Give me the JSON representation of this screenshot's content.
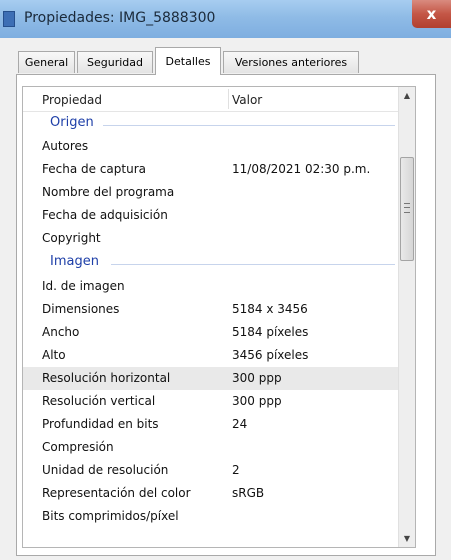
{
  "window": {
    "title": "Propiedades: IMG_5888300",
    "close_label": "x"
  },
  "tabs": [
    {
      "label": "General",
      "active": false
    },
    {
      "label": "Seguridad",
      "active": false
    },
    {
      "label": "Detalles",
      "active": true
    },
    {
      "label": "Versiones anteriores",
      "active": false
    }
  ],
  "list": {
    "columns": {
      "property": "Propiedad",
      "value": "Valor"
    },
    "groups": [
      {
        "name": "Origen",
        "rows": [
          {
            "property": "Autores",
            "value": ""
          },
          {
            "property": "Fecha de captura",
            "value": "11/08/2021 02:30 p.m."
          },
          {
            "property": "Nombre del programa",
            "value": ""
          },
          {
            "property": "Fecha de adquisición",
            "value": ""
          },
          {
            "property": "Copyright",
            "value": ""
          }
        ]
      },
      {
        "name": "Imagen",
        "rows": [
          {
            "property": "Id. de imagen",
            "value": ""
          },
          {
            "property": "Dimensiones",
            "value": "5184 x 3456"
          },
          {
            "property": "Ancho",
            "value": "5184 píxeles"
          },
          {
            "property": "Alto",
            "value": "3456 píxeles"
          },
          {
            "property": "Resolución horizontal",
            "value": "300 ppp",
            "highlighted": true
          },
          {
            "property": "Resolución vertical",
            "value": "300 ppp"
          },
          {
            "property": "Profundidad en bits",
            "value": "24"
          },
          {
            "property": "Compresión",
            "value": ""
          },
          {
            "property": "Unidad de resolución",
            "value": "2"
          },
          {
            "property": "Representación del color",
            "value": "sRGB"
          },
          {
            "property": "Bits comprimidos/píxel",
            "value": ""
          }
        ]
      }
    ]
  },
  "colors": {
    "group_label": "#1e3fa8",
    "highlight_row": "#e9e9e9",
    "titlebar": "#8fbbe6",
    "close_button": "#c45646"
  },
  "icons": {
    "window": "window-app-icon",
    "scroll_up": "scroll-up-arrow-icon",
    "scroll_down": "scroll-down-arrow-icon"
  }
}
